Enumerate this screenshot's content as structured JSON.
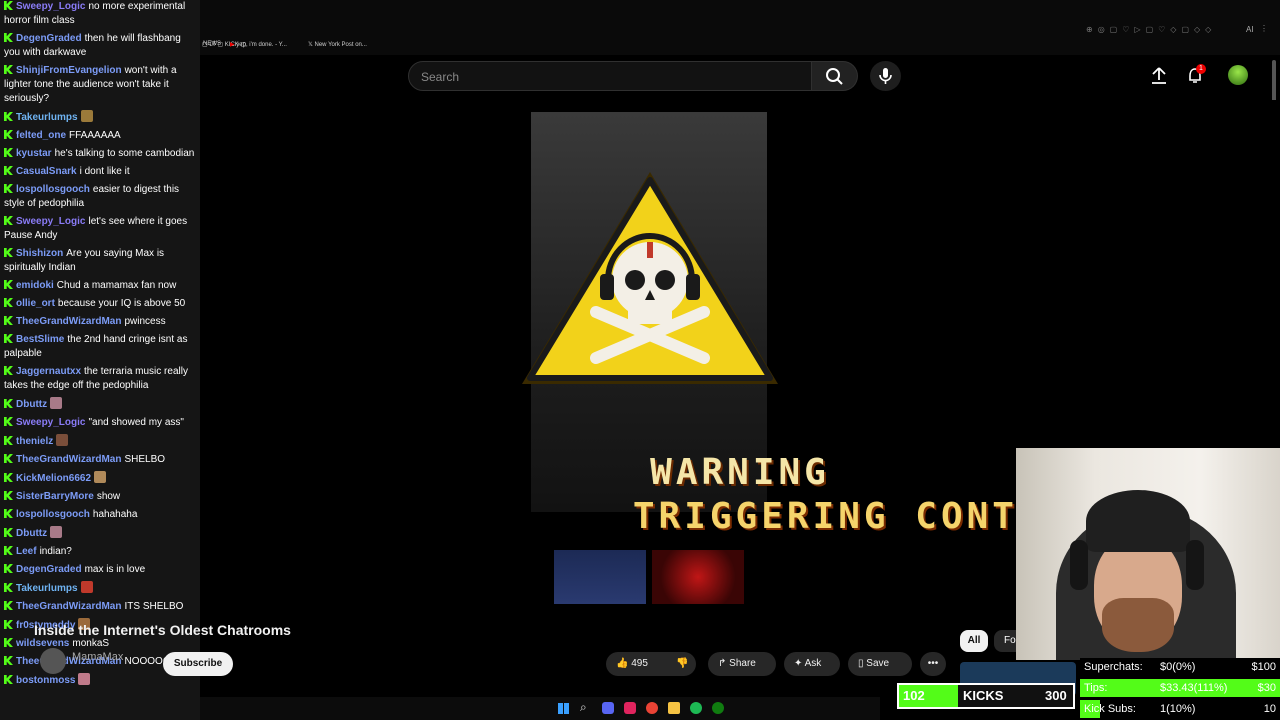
{
  "chat": {
    "messages": [
      {
        "user": "Sweepy_Logic",
        "text": "no more experimental horror film class",
        "color": "#8a7cf7"
      },
      {
        "user": "DegenGraded",
        "text": "then he will flashbang you with darkwave",
        "color": "#7c9cf7"
      },
      {
        "user": "ShinjiFromEvangelion",
        "text": "won't with a lighter tone the audience won't take it seriously?",
        "color": "#7c9cf7"
      },
      {
        "user": "Takeurlumps",
        "text": "",
        "color": "#6fb3f2",
        "emote": "#9b7a3a"
      },
      {
        "user": "felted_one",
        "text": "FFAAAAAA",
        "color": "#7c9cf7"
      },
      {
        "user": "kyustar",
        "text": "he's talking to some cambodian",
        "color": "#7c9cf7"
      },
      {
        "user": "CasualSnark",
        "text": "i dont like it",
        "color": "#7c9cf7"
      },
      {
        "user": "lospollosgooch",
        "text": "easier to digest this style of pedophilia",
        "color": "#7c9cf7"
      },
      {
        "user": "Sweepy_Logic",
        "text": "let's see where it goes Pause Andy",
        "color": "#8a7cf7"
      },
      {
        "user": "Shishizon",
        "text": "Are you saying Max is spiritually Indian",
        "color": "#7c9cf7"
      },
      {
        "user": "emidoki",
        "text": "Chud a mamamax fan now",
        "color": "#7c9cf7"
      },
      {
        "user": "ollie_ort",
        "text": "because your IQ is above 50",
        "color": "#7c9cf7"
      },
      {
        "user": "TheeGrandWizardMan",
        "text": "pwincess",
        "color": "#7c9cf7"
      },
      {
        "user": "BestSlime",
        "text": "the 2nd hand cringe isnt as palpable",
        "color": "#7c9cf7"
      },
      {
        "user": "Jaggernautxx",
        "text": "the terraria music really takes the edge off the pedophilia",
        "color": "#7c9cf7"
      },
      {
        "user": "Dbuttz",
        "text": "",
        "color": "#7c9cf7",
        "emote": "#a87a88"
      },
      {
        "user": "Sweepy_Logic",
        "text": "\"and showed my ass\"",
        "color": "#8a7cf7"
      },
      {
        "user": "thenielz",
        "text": "",
        "color": "#7c9cf7",
        "emote": "#7a4e3a"
      },
      {
        "user": "TheeGrandWizardMan",
        "text": "SHELBO",
        "color": "#7c9cf7"
      },
      {
        "user": "KickMelion6662",
        "text": "",
        "color": "#7c9cf7",
        "emote": "#b08a5a"
      },
      {
        "user": "SisterBarryMore",
        "text": "show",
        "color": "#7c9cf7"
      },
      {
        "user": "lospollosgooch",
        "text": "hahahaha",
        "color": "#7c9cf7"
      },
      {
        "user": "Dbuttz",
        "text": "",
        "color": "#7c9cf7",
        "emote": "#a87a88"
      },
      {
        "user": "Leef",
        "text": "indian?",
        "color": "#7c9cf7"
      },
      {
        "user": "DegenGraded",
        "text": "max is in love",
        "color": "#7c9cf7"
      },
      {
        "user": "Takeurlumps",
        "text": "",
        "color": "#6fb3f2",
        "emote": "#c0392b"
      },
      {
        "user": "TheeGrandWizardMan",
        "text": "ITS SHELBO",
        "color": "#7c9cf7"
      },
      {
        "user": "fr0stymeddy",
        "text": "",
        "color": "#7c9cf7",
        "emote": "#9b6a3a"
      },
      {
        "user": "wildsevens",
        "text": "monkaS",
        "color": "#7c9cf7"
      },
      {
        "user": "TheeGrandWizardMan",
        "text": "NOOOOO",
        "color": "#7c9cf7"
      },
      {
        "user": "bostonmoss",
        "text": "",
        "color": "#7c9cf7",
        "emote": "#c07a8a"
      }
    ]
  },
  "browser": {
    "bookmarks": [
      "NEWS",
      "yep, i'm done. - Y...",
      "New York Post on..."
    ],
    "extensions_label": "AI"
  },
  "youtube": {
    "search_placeholder": "Search",
    "notification_count": "1",
    "video": {
      "warning_line1": "WARNING",
      "warning_line2": "TRIGGERING CONTENT"
    },
    "title": "Inside the Internet's Oldest Chatrooms",
    "channel": "MamaMax",
    "subscribe_label": "Subscribe",
    "like_count": "495",
    "share_label": "Share",
    "ask_label": "Ask",
    "save_label": "Save",
    "filter_all": "All",
    "filter_next": "Fo"
  },
  "overlay": {
    "kick_count": "102",
    "kick_label": "KICKS",
    "kick_goal": "300",
    "kick_progress": 0.34,
    "superchats_label": "Superchats:",
    "superchats_value": "$0(0%)",
    "superchats_goal": "$100",
    "tips_label": "Tips:",
    "tips_value": "$33.43(111%)",
    "tips_goal": "$30",
    "subs_label": "Kick Subs:",
    "subs_value": "1(10%)",
    "subs_goal": "10",
    "accent_green": "#53fc18"
  }
}
